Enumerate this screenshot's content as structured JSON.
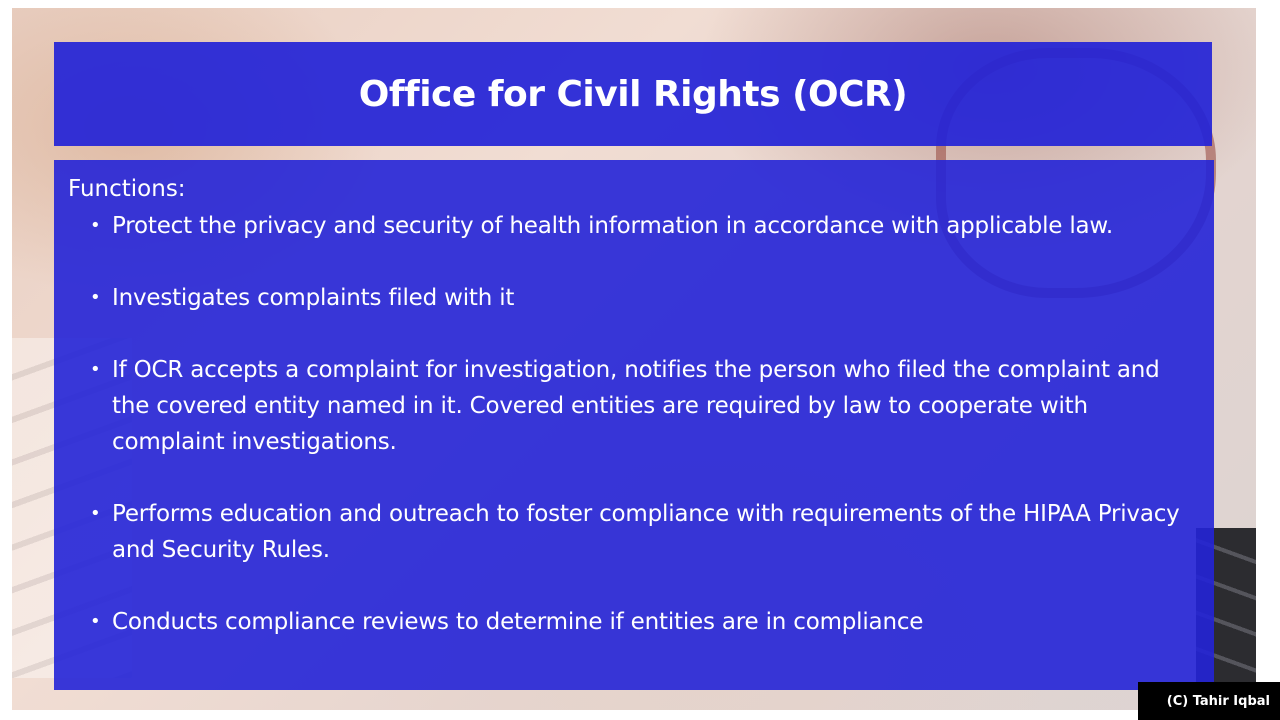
{
  "slide": {
    "title": "Office for Civil Rights (OCR)",
    "section_label": "Functions:",
    "bullets": [
      {
        "text": "Protect the privacy and security of health information in accordance with applicable law."
      },
      {
        "text": "Investigates complaints filed with it"
      },
      {
        "text": "If OCR accepts a complaint for investigation, notifies  the person who filed the complaint and the covered entity named in it. Covered entities are required by law to cooperate with complaint investigations."
      },
      {
        "text": "Performs education and outreach to foster compliance with requirements of the HIPAA Privacy and Security Rules."
      },
      {
        "text": "Conducts compliance reviews to determine if entities are in compliance"
      }
    ],
    "bullet_glyph": "•"
  },
  "watermark": {
    "text": "(C) Tahir Iqbal"
  },
  "colors": {
    "panel": "#2323d7",
    "text": "#ffffff",
    "watermark_bg": "#000000"
  }
}
